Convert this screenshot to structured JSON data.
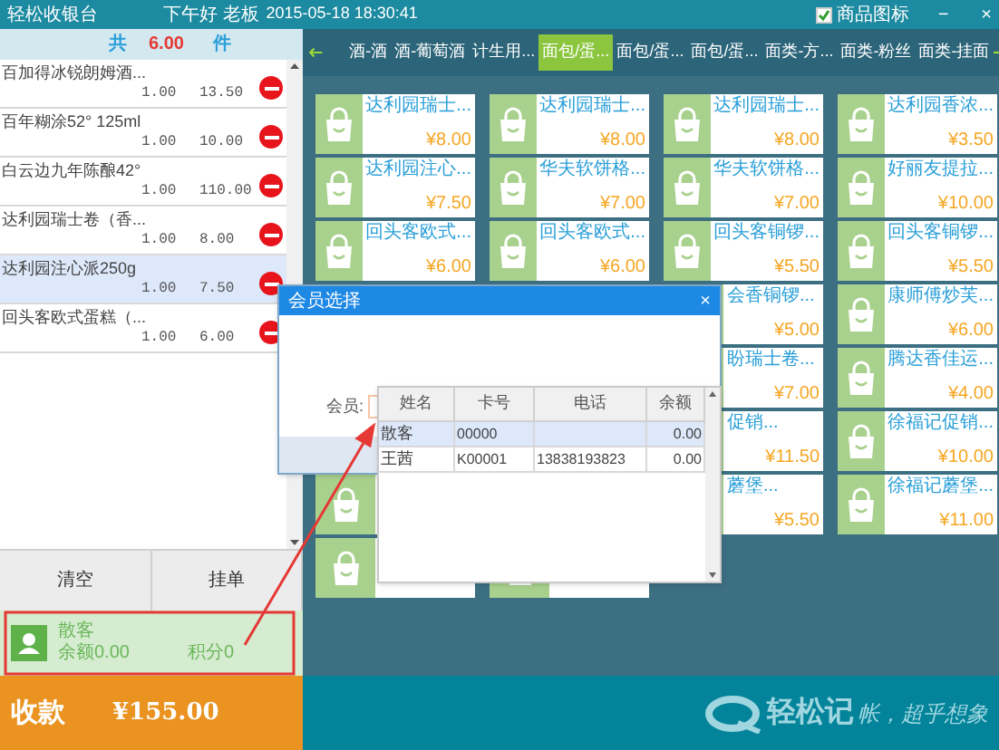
{
  "title_bar": {
    "app_name": "轻松收银台",
    "greeting": "下午好 老板",
    "datetime": "2015-05-18 18:30:41",
    "icon_toggle": {
      "label": "商品图标",
      "checked": true
    },
    "minimize": "−",
    "close": "×"
  },
  "cart": {
    "total_prefix": "共",
    "total_count": "6.00",
    "total_suffix": "件",
    "items": [
      {
        "name": "百加得冰锐朗姆酒...",
        "qty": "1.00",
        "amount": "13.50",
        "selected": false
      },
      {
        "name": "百年糊涂52° 125ml",
        "qty": "1.00",
        "amount": "10.00",
        "selected": false
      },
      {
        "name": "白云边九年陈酿42°",
        "qty": "1.00",
        "amount": "110.00",
        "selected": false
      },
      {
        "name": "达利园瑞士卷（香...",
        "qty": "1.00",
        "amount": "8.00",
        "selected": false
      },
      {
        "name": "达利园注心派250g",
        "qty": "1.00",
        "amount": "7.50",
        "selected": true
      },
      {
        "name": "回头客欧式蛋糕（...",
        "qty": "1.00",
        "amount": "6.00",
        "selected": false
      }
    ]
  },
  "actions": [
    "清空",
    "挂单"
  ],
  "member": {
    "name": "散客",
    "balance": "余额0.00",
    "points": "积分0"
  },
  "checkout": {
    "label": "收款",
    "amount": "¥155.00"
  },
  "categories": [
    {
      "label": "酒-酒",
      "selected": false
    },
    {
      "label": "酒-葡萄酒",
      "selected": false
    },
    {
      "label": "计生用...",
      "selected": false
    },
    {
      "label": "面包/蛋...",
      "selected": true
    },
    {
      "label": "面包/蛋...",
      "selected": false
    },
    {
      "label": "面包/蛋...",
      "selected": false
    },
    {
      "label": "面类-方...",
      "selected": false
    },
    {
      "label": "面类-粉丝",
      "selected": false
    },
    {
      "label": "面类-挂面",
      "selected": false
    }
  ],
  "product_columns": [
    {
      "products": [
        {
          "kind": "item",
          "name": "达利园瑞士...",
          "price": "¥8.00"
        },
        {
          "kind": "item",
          "name": "达利园注心...",
          "price": "¥7.50"
        },
        {
          "kind": "item",
          "name": "回头客欧式...",
          "price": "¥6.00"
        },
        {
          "kind": "blank"
        },
        {
          "kind": "blank"
        }
      ]
    },
    {
      "products": [
        {
          "kind": "item",
          "name": "达利园瑞士...",
          "price": "¥8.00"
        },
        {
          "kind": "item",
          "name": "华夫软饼格...",
          "price": "¥7.00"
        },
        {
          "kind": "item",
          "name": "回头客欧式...",
          "price": "¥6.00"
        },
        {
          "kind": "blank"
        }
      ]
    },
    {
      "products": [
        {
          "kind": "item",
          "name": "达利园瑞士...",
          "price": "¥8.00"
        },
        {
          "kind": "item",
          "name": "华夫软饼格...",
          "price": "¥7.00"
        },
        {
          "kind": "item",
          "name": "回头客铜锣...",
          "price": "¥5.50"
        },
        {
          "kind": "covered",
          "name": "会香铜锣...",
          "price": "¥5.00"
        },
        {
          "kind": "covered",
          "name": "盼瑞士卷...",
          "price": "¥7.00"
        },
        {
          "kind": "covered",
          "name": "促销...",
          "price": "¥11.50"
        },
        {
          "kind": "covered",
          "name": "蘑堡...",
          "price": "¥5.50"
        }
      ]
    },
    {
      "products": [
        {
          "kind": "item",
          "name": "达利园香浓...",
          "price": "¥3.50"
        },
        {
          "kind": "item",
          "name": "好丽友提拉...",
          "price": "¥10.00"
        },
        {
          "kind": "item",
          "name": "回头客铜锣...",
          "price": "¥5.50"
        },
        {
          "kind": "item",
          "name": "康师傅炒芙...",
          "price": "¥6.00"
        },
        {
          "kind": "item",
          "name": "腾达香佳运...",
          "price": "¥4.00"
        },
        {
          "kind": "item",
          "name": "徐福记促销...",
          "price": "¥10.00"
        },
        {
          "kind": "item",
          "name": "徐福记蘑堡...",
          "price": "¥11.00"
        }
      ]
    }
  ],
  "brand": {
    "name": "轻松记",
    "slogan": "帐，超乎想象"
  },
  "dialog": {
    "title": "会员选择",
    "close": "×",
    "field_label": "会员:",
    "table": {
      "columns": [
        "姓名",
        "卡号",
        "电话",
        "余额"
      ],
      "rows": [
        {
          "cells": [
            "散客",
            "00000",
            "",
            "0.00"
          ],
          "selected": true
        },
        {
          "cells": [
            "王茜",
            "K00001",
            "13838193823",
            "0.00"
          ],
          "selected": false
        }
      ]
    }
  }
}
